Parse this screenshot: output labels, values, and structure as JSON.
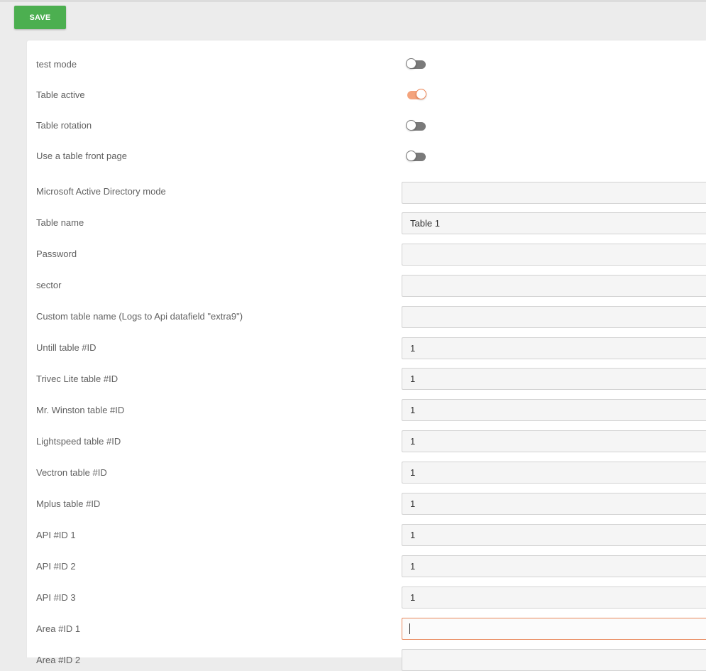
{
  "toolbar": {
    "save_label": "SAVE"
  },
  "toggles": [
    {
      "label": "test mode",
      "on": false
    },
    {
      "label": "Table active",
      "on": true
    },
    {
      "label": "Table rotation",
      "on": false
    },
    {
      "label": "Use a table front page",
      "on": false
    }
  ],
  "fields": [
    {
      "label": "Microsoft Active Directory mode",
      "value": ""
    },
    {
      "label": "Table name",
      "value": "Table 1"
    },
    {
      "label": "Password",
      "value": ""
    },
    {
      "label": "sector",
      "value": ""
    },
    {
      "label": "Custom table name (Logs to Api datafield \"extra9\")",
      "value": ""
    },
    {
      "label": "Untill table #ID",
      "value": "1"
    },
    {
      "label": "Trivec Lite table #ID",
      "value": "1"
    },
    {
      "label": "Mr. Winston table #ID",
      "value": "1"
    },
    {
      "label": "Lightspeed table #ID",
      "value": "1"
    },
    {
      "label": "Vectron table #ID",
      "value": "1"
    },
    {
      "label": "Mplus table #ID",
      "value": "1"
    },
    {
      "label": "API #ID 1",
      "value": "1"
    },
    {
      "label": "API #ID 2",
      "value": "1"
    },
    {
      "label": "API #ID 3",
      "value": "1"
    },
    {
      "label": "Area #ID 1",
      "value": "",
      "focused": true
    },
    {
      "label": "Area #ID 2",
      "value": ""
    }
  ],
  "colors": {
    "save_button": "#4caf50",
    "toggle_on": "#f4a37c",
    "focus_border": "#e8875a"
  }
}
